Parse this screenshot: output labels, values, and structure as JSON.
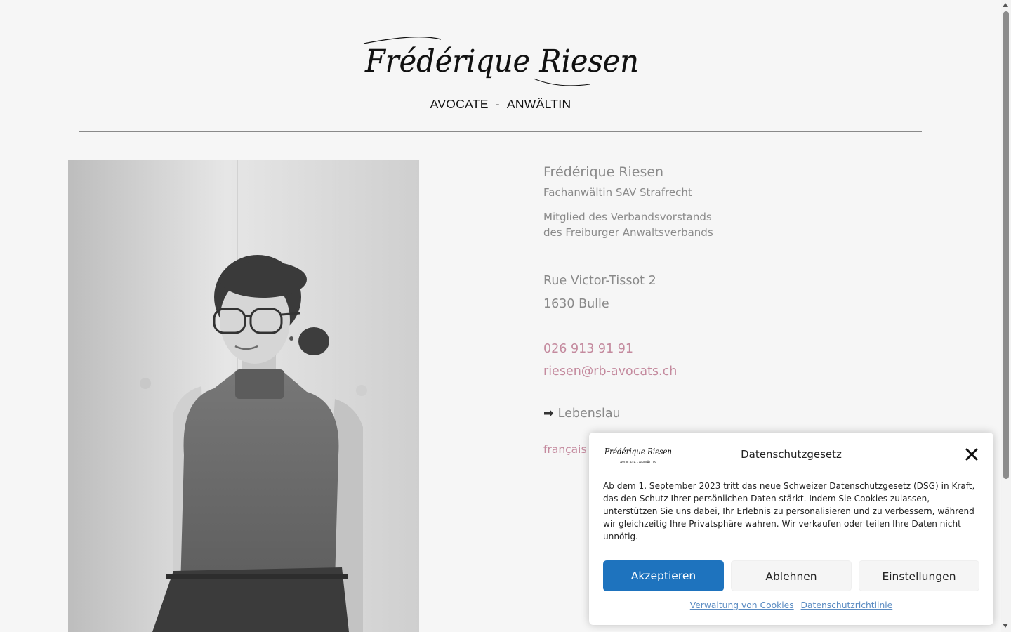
{
  "header": {
    "logo_text": "Frédérique Riesen",
    "tagline_left": "AVOCATE",
    "tagline_sep": "-",
    "tagline_right": "ANWÄLTIN"
  },
  "profile": {
    "name": "Frédérique Riesen",
    "specialization": "Fachanwältin SAV Strafrecht",
    "membership_line1": "Mitglied des Verbandsvorstands",
    "membership_line2": "des Freiburger Anwaltsverbands",
    "street": "Rue Victor-Tissot 2",
    "city": "1630 Bulle",
    "phone": "026 913 91 91",
    "email": "riesen@rb-avocats.ch",
    "cv_label": "Lebenslau",
    "language": "français"
  },
  "cookie_banner": {
    "title": "Datenschutzgesetz",
    "body": "Ab dem 1. September 2023 tritt das neue Schweizer Datenschutzgesetz (DSG) in Kraft, das den Schutz Ihrer persönlichen Daten stärkt. Indem Sie Cookies zulassen, unterstützen Sie uns dabei, Ihr Erlebnis zu personalisieren und zu verbessern, während wir gleichzeitig Ihre Privatsphäre wahren. Wir verkaufen oder teilen Ihre Daten nicht unnötig.",
    "accept_label": "Akzeptieren",
    "deny_label": "Ablehnen",
    "preferences_label": "Einstellungen",
    "manage_link": "Verwaltung von Cookies",
    "privacy_link": "Datenschutzrichtlinie",
    "logo_text": "Frédérique Riesen",
    "logo_tagline": "AVOCATE  -  ANWÄLTIN"
  },
  "icons": {
    "cv_arrow": "arrow-right-icon",
    "close": "close-icon"
  },
  "colors": {
    "background": "#f6f6f6",
    "link_pink": "#c48a9e",
    "accept_blue": "#1e73be",
    "text_grey": "#8a8a8a"
  }
}
